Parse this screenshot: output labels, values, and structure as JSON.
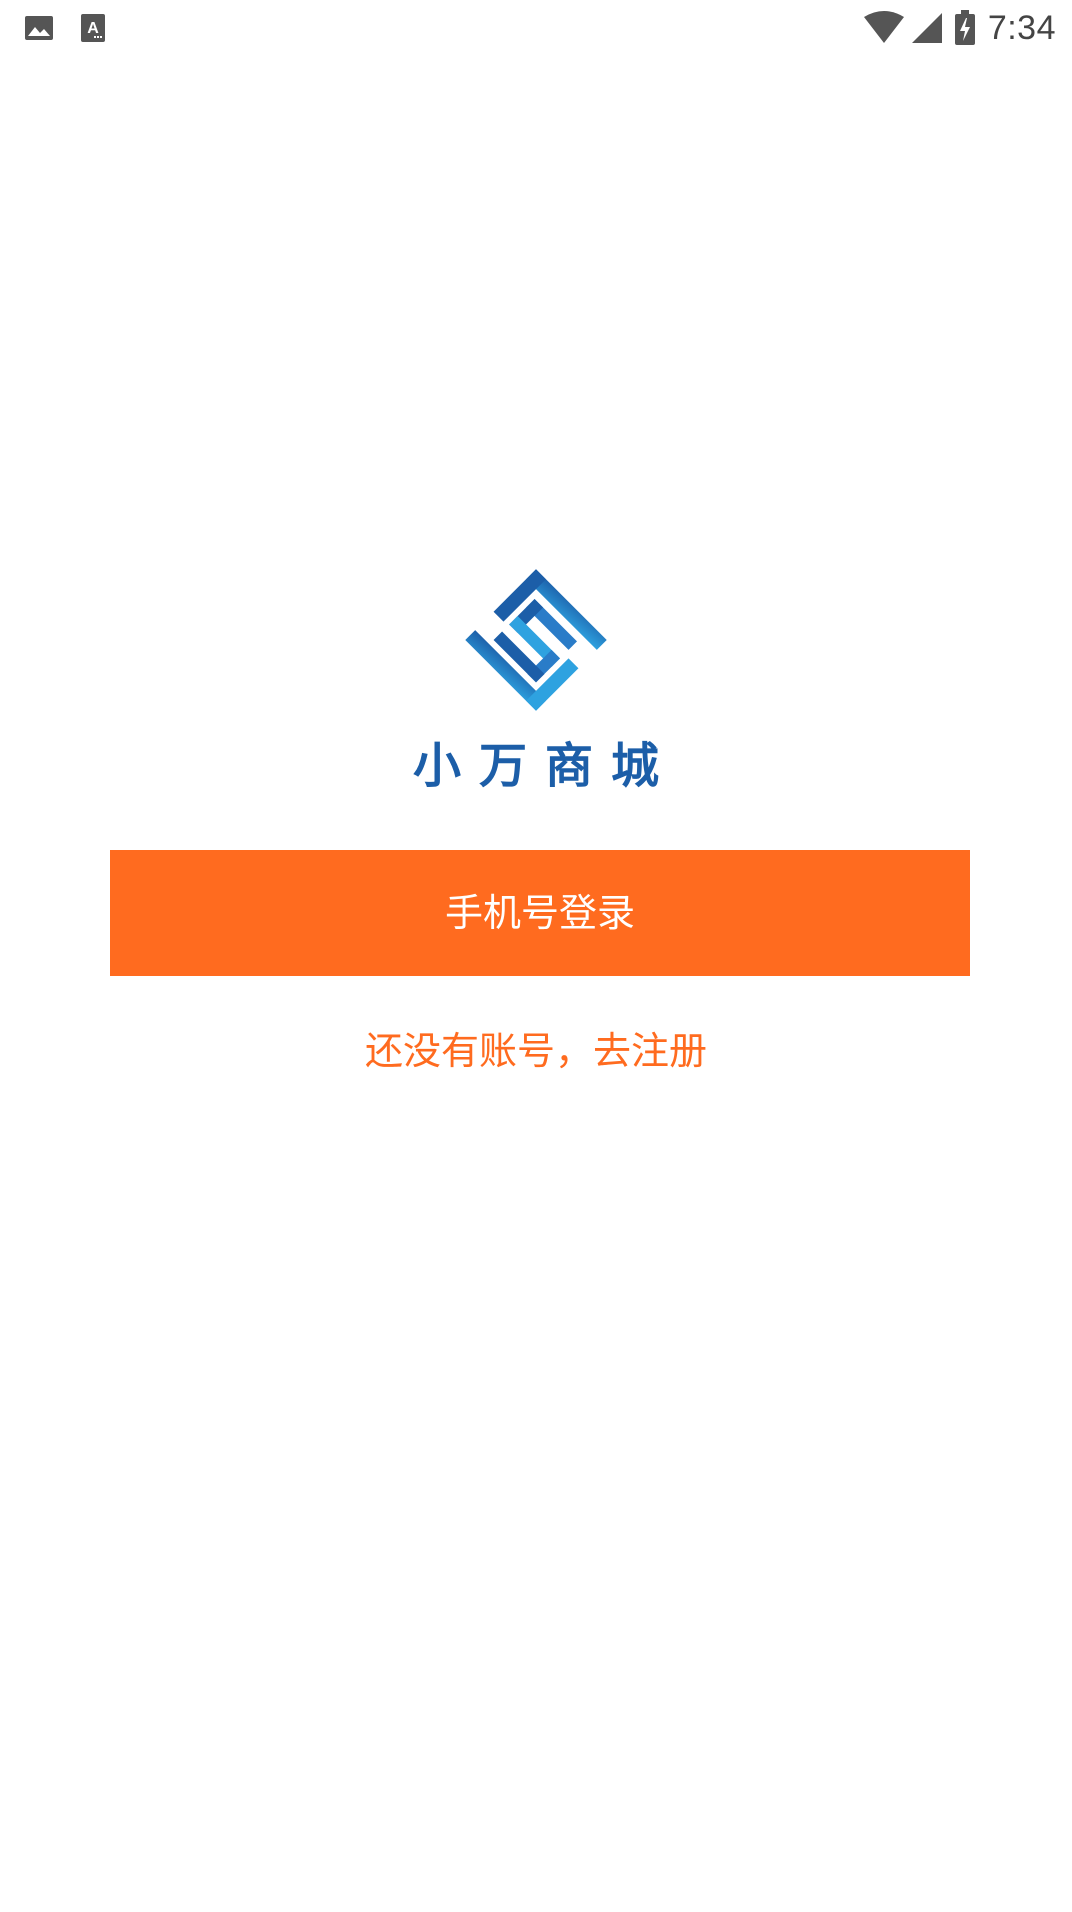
{
  "status_bar": {
    "time": "7:34",
    "left_icons": [
      "image-icon",
      "text-a-icon"
    ],
    "right_icons": [
      "wifi-icon",
      "cell-signal-icon",
      "battery-charging-icon"
    ]
  },
  "brand": {
    "logo_icon": "logo-icon",
    "name": "小万商城",
    "colors": {
      "primary": "#1c5ea8",
      "secondary": "#2ea2e0"
    }
  },
  "actions": {
    "login_label": "手机号登录",
    "register_label": "还没有账号，去注册"
  },
  "theme": {
    "accent": "#ff6b1f",
    "background": "#ffffff"
  }
}
